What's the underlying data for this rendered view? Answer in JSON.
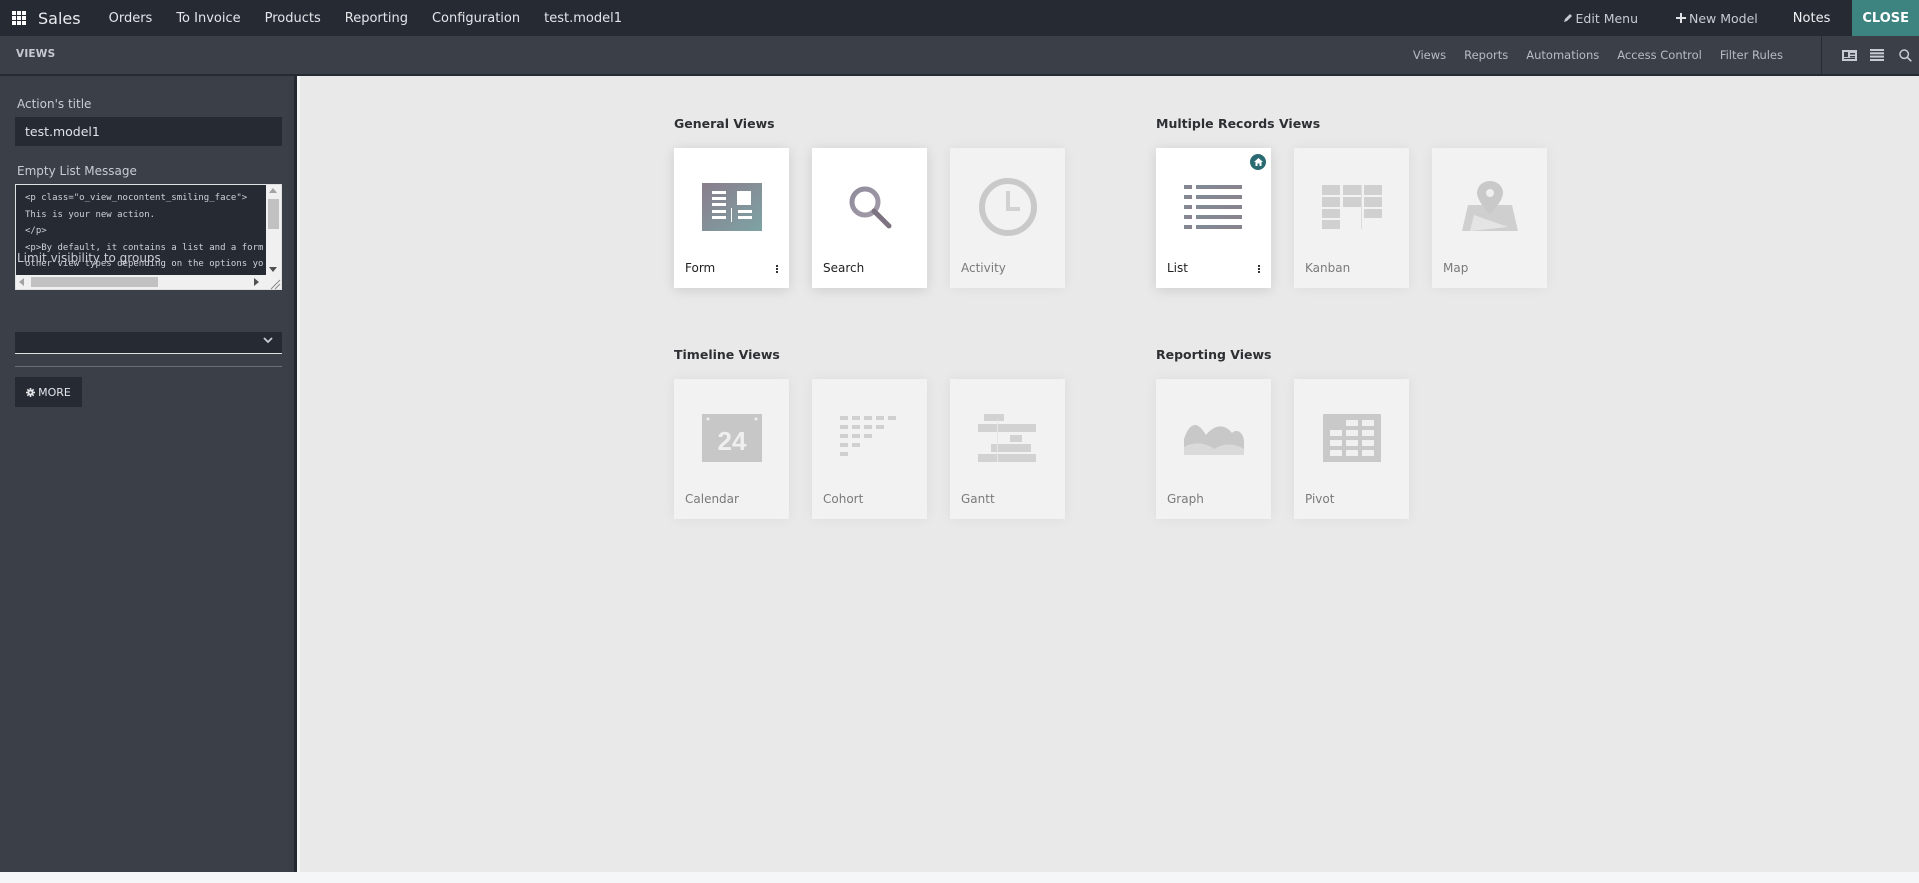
{
  "navbar": {
    "brand": "Sales",
    "menu": [
      "Orders",
      "To Invoice",
      "Products",
      "Reporting",
      "Configuration",
      "test.model1"
    ],
    "right": {
      "edit_menu": "Edit Menu",
      "new_model": "New Model",
      "notes": "Notes",
      "close": "CLOSE"
    }
  },
  "subheader": {
    "title": "VIEWS",
    "links": [
      "Views",
      "Reports",
      "Automations",
      "Access Control",
      "Filter Rules"
    ],
    "icons": [
      "properties-card-icon",
      "list-lines-icon",
      "search-icon"
    ]
  },
  "sidebar": {
    "action_title_label": "Action's title",
    "action_title_value": "test.model1",
    "empty_list_label": "Empty List Message",
    "empty_list_lines": [
      "<p class=\"o_view_nocontent_smiling_face\">",
      "This is your new action.",
      "</p>",
      "<p>By default, it contains a list and a form",
      "other view types depending on the options yo"
    ],
    "groups_label": "Limit visibility to groups",
    "groups_value": "",
    "more_button": "MORE"
  },
  "main": {
    "groups": [
      {
        "title": "General Views",
        "views": [
          {
            "label": "Form",
            "active": true,
            "menu": true
          },
          {
            "label": "Search",
            "active": true,
            "menu": false
          },
          {
            "label": "Activity",
            "active": false,
            "menu": false
          }
        ]
      },
      {
        "title": "Multiple Records Views",
        "views": [
          {
            "label": "List",
            "active": true,
            "menu": true,
            "default": true
          },
          {
            "label": "Kanban",
            "active": false,
            "menu": false
          },
          {
            "label": "Map",
            "active": false,
            "menu": false
          }
        ]
      },
      {
        "title": "Timeline Views",
        "views": [
          {
            "label": "Calendar",
            "active": false,
            "menu": false,
            "calendar_day": "24"
          },
          {
            "label": "Cohort",
            "active": false,
            "menu": false
          },
          {
            "label": "Gantt",
            "active": false,
            "menu": false
          }
        ]
      },
      {
        "title": "Reporting Views",
        "views": [
          {
            "label": "Graph",
            "active": false,
            "menu": false
          },
          {
            "label": "Pivot",
            "active": false,
            "menu": false
          }
        ]
      }
    ]
  },
  "colors": {
    "navbar_bg": "#262a33",
    "subheader_bg": "#3a3f48",
    "close_button_bg": "#3d8480",
    "home_badge_bg": "#2a6a73",
    "main_bg": "#e9e9e9"
  }
}
